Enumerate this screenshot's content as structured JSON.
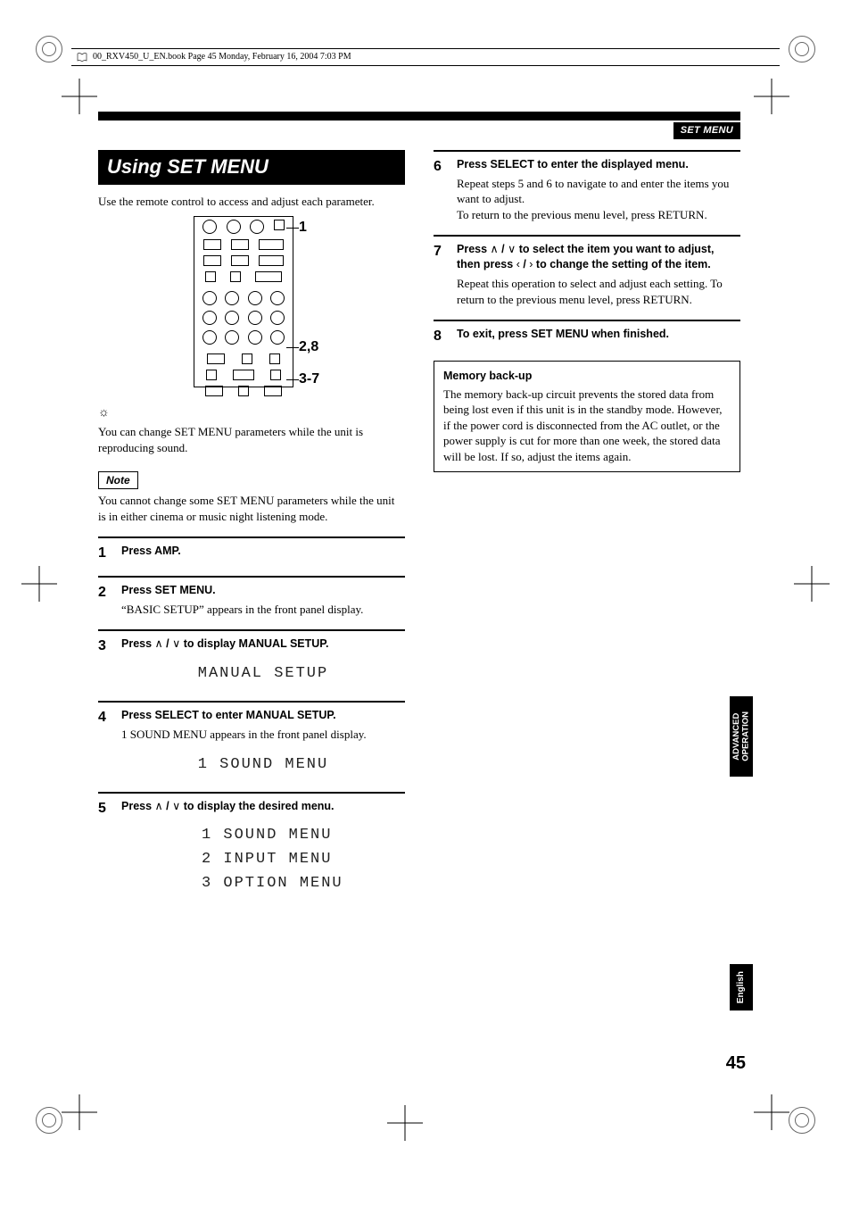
{
  "header": {
    "filename": "00_RXV450_U_EN.book  Page 45  Monday, February 16, 2004  7:03 PM"
  },
  "section_tag": "SET MENU",
  "title": "Using SET MENU",
  "intro": "Use the remote control to access and adjust each parameter.",
  "remote_callouts": {
    "c1": "1",
    "c2": "2,8",
    "c3": "3-7"
  },
  "tip_text": "You can change SET MENU parameters while the unit is reproducing sound.",
  "note_label": "Note",
  "note_text": "You cannot change some SET MENU parameters while the unit is in either cinema or music night listening mode.",
  "steps_left": [
    {
      "n": "1",
      "head": "Press AMP."
    },
    {
      "n": "2",
      "head": "Press SET MENU.",
      "body": "“BASIC SETUP” appears in the front panel display."
    },
    {
      "n": "3",
      "head_pre": "Press ",
      "head_post": " to display MANUAL SETUP.",
      "lcd": "MANUAL SETUP"
    },
    {
      "n": "4",
      "head": "Press SELECT to enter MANUAL SETUP.",
      "body": "1 SOUND MENU appears in the front panel display.",
      "lcd": "1 SOUND MENU"
    },
    {
      "n": "5",
      "head_pre": "Press ",
      "head_post": " to display the desired menu.",
      "lcd_lines": [
        "1 SOUND MENU",
        "2 INPUT MENU",
        "3 OPTION MENU"
      ]
    }
  ],
  "steps_right": [
    {
      "n": "6",
      "head": "Press SELECT to enter the displayed menu.",
      "body": "Repeat steps 5 and 6 to navigate to and enter the items you want to adjust.",
      "body2": "To return to the previous menu level, press RETURN."
    },
    {
      "n": "7",
      "head_pre": "Press ",
      "head_mid": " to select the item you want to adjust, then press ",
      "head_post": " to change the setting of the item.",
      "body": "Repeat this operation to select and adjust each setting. To return to the previous menu level, press RETURN."
    },
    {
      "n": "8",
      "head": "To exit, press SET MENU when finished."
    }
  ],
  "memo": {
    "title": "Memory back-up",
    "text": "The memory back-up circuit prevents the stored data from being lost even if this unit is in the standby mode. However, if the power cord is disconnected from the AC outlet, or the power supply is cut for more than one week, the stored data will be lost. If so, adjust the items again."
  },
  "side_tabs": {
    "advanced_l1": "ADVANCED",
    "advanced_l2": "OPERATION",
    "english": "English"
  },
  "page_number": "45",
  "arrow_glyphs": {
    "up": "∧",
    "down": "∨",
    "left": "‹",
    "right": "›"
  }
}
